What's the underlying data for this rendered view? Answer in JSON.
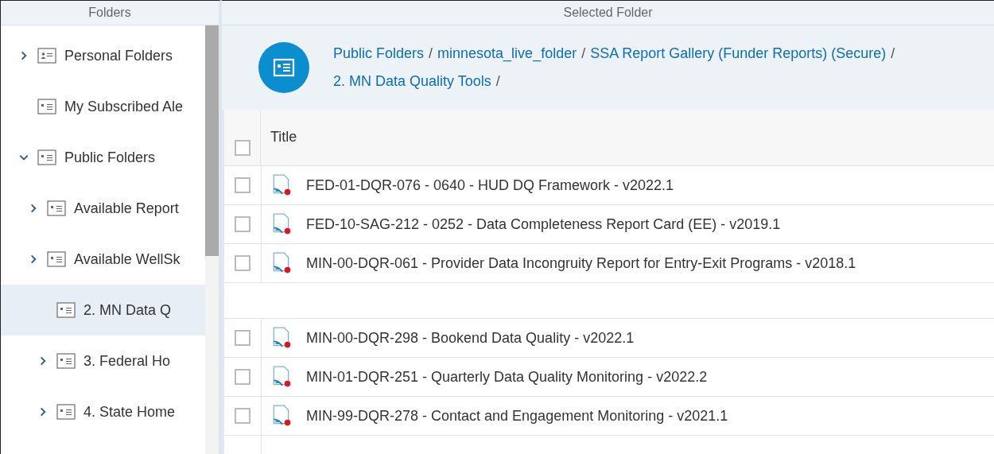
{
  "folders_panel": {
    "title": "Folders",
    "tree": [
      {
        "label": "Personal Folders",
        "kind": "personal",
        "expanded": false,
        "selected": false
      },
      {
        "label": "My Subscribed Ale",
        "kind": "folder",
        "selected": false
      },
      {
        "label": "Public Folders",
        "kind": "folder",
        "expanded": true,
        "selected": false,
        "children": [
          {
            "label": "Available Report",
            "kind": "folder",
            "expanded": false,
            "selected": false
          },
          {
            "label": "Available WellSk",
            "kind": "folder",
            "expanded": false,
            "selected": false
          },
          {
            "kind": "group",
            "children": [
              {
                "label": "2. MN Data Q",
                "kind": "folder",
                "selected": true
              },
              {
                "label": "3. Federal Ho",
                "kind": "folder",
                "expanded": false,
                "selected": false
              },
              {
                "label": "4. State Home",
                "kind": "folder",
                "expanded": false,
                "selected": false
              }
            ]
          }
        ]
      }
    ]
  },
  "selected_folder": {
    "title": "Selected Folder",
    "breadcrumb": [
      {
        "label": "Public Folders",
        "separator": "/"
      },
      {
        "label": "minnesota_live_folder",
        "separator": "/"
      },
      {
        "label": "SSA Report Gallery (Funder Reports) (Secure)",
        "separator": "/"
      },
      {
        "label": "2. MN Data Quality Tools",
        "separator": "/"
      }
    ],
    "table": {
      "columns": [
        "Title"
      ],
      "header_checked": false,
      "rows": [
        {
          "kind": "report",
          "title": "FED-01-DQR-076 - 0640 - HUD DQ Framework - v2022.1",
          "checked": false
        },
        {
          "kind": "report",
          "title": "FED-10-SAG-212 - 0252 - Data Completeness Report Card (EE) - v2019.1",
          "checked": false
        },
        {
          "kind": "report",
          "title": "MIN-00-DQR-061 - Provider Data Incongruity Report for Entry-Exit Programs - v2018.1",
          "checked": false
        },
        {
          "kind": "gap"
        },
        {
          "kind": "report",
          "title": "MIN-00-DQR-298 - Bookend Data Quality - v2022.1",
          "checked": false
        },
        {
          "kind": "report",
          "title": "MIN-01-DQR-251 - Quarterly Data Quality Monitoring - v2022.2",
          "checked": false
        },
        {
          "kind": "report",
          "title": "MIN-99-DQR-278 - Contact and Engagement Monitoring - v2021.1",
          "checked": false
        }
      ]
    }
  }
}
